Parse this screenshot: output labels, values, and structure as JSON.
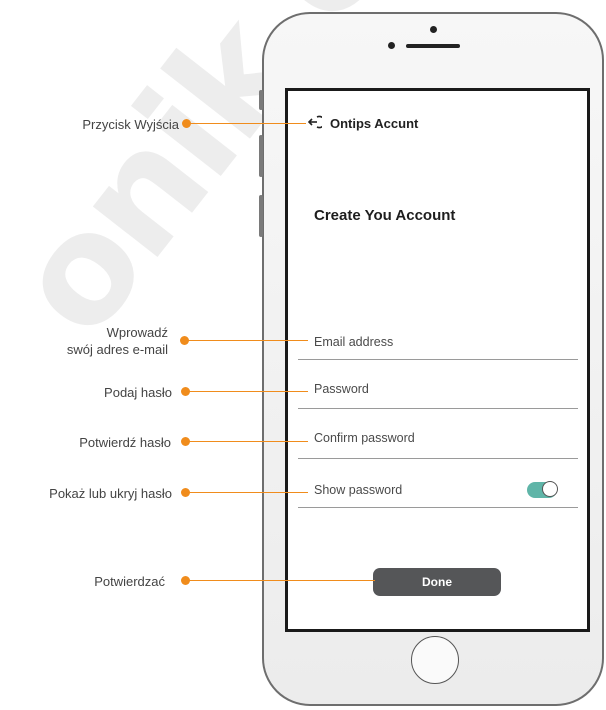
{
  "watermark": "onik.c",
  "app": {
    "title": "Ontips Accunt",
    "heading": "Create You Account"
  },
  "form": {
    "email_label": "Email address",
    "password_label": "Password",
    "confirm_label": "Confirm password",
    "show_password_label": "Show password",
    "show_password_on": true,
    "done_label": "Done"
  },
  "callouts": {
    "back": "Przycisk Wyjścia",
    "email_line1": "Wprowadź",
    "email_line2": "swój adres e-mail",
    "password": "Podaj hasło",
    "confirm": "Potwierdź hasło",
    "show": "Pokaż lub ukryj hasło",
    "done": "Potwierdzać"
  },
  "colors": {
    "accent": "#f08c1c",
    "toggle_on": "#5fb5a8",
    "button": "#555658"
  },
  "icons": {
    "back": "exit-arrow-icon",
    "home": "home-button-icon"
  }
}
